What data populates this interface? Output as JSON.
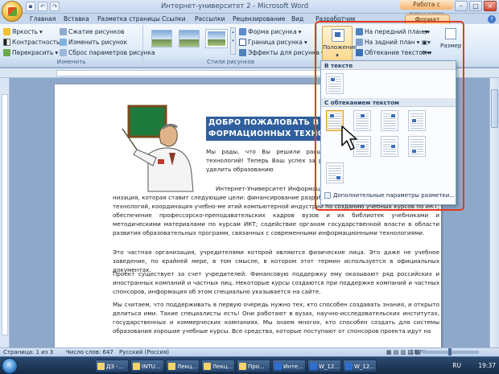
{
  "window": {
    "title": "Интернет-университет 2 - Microsoft Word",
    "context_title": "Работа с рисунками"
  },
  "tabs": [
    {
      "label": "Главная"
    },
    {
      "label": "Вставка"
    },
    {
      "label": "Разметка страницы"
    },
    {
      "label": "Ссылки"
    },
    {
      "label": "Рассылки"
    },
    {
      "label": "Рецензирование"
    },
    {
      "label": "Вид"
    },
    {
      "label": "Разработчик"
    },
    {
      "label": "Формат"
    }
  ],
  "ribbon": {
    "adjust": {
      "brightness": "Яркость",
      "contrast": "Контрастность",
      "recolor": "Перекрасить",
      "compress": "Сжатие рисунков",
      "change": "Изменить рисунок",
      "reset": "Сброс параметров рисунка",
      "label": "Изменить"
    },
    "styles": {
      "shape": "Форма рисунка",
      "border": "Граница рисунка",
      "effects": "Эффекты для рисунка",
      "label": "Стили рисунков"
    },
    "arrange": {
      "position": "Положение",
      "front": "На передний план",
      "back": "На задний план",
      "wrap": "Обтекание текстом"
    },
    "size": "Размер"
  },
  "popup": {
    "section_inline": "В тексте",
    "section_wrap": "С обтеканием текстом",
    "more": "Дополнительные параметры разметки..."
  },
  "document": {
    "heading": "ДОБРО ПОЖАЛОВАТЬ В И ФОРМАЦИОННЫХ ТЕХНОЛОГ",
    "p1": "Мы рады, что Вы решили расширить с ных технологий! Теперь Ваш успех за рые Вы готовы уделить образованию",
    "p2a": "Интернет-Университет Информацион",
    "p2b": "низация, которая ставит следующие цели: финансирование разработо формационно-коммуникационных технологий, координация учебно-ме ятий компьютерной индустрии по созданию учебных курсов по ИКТ; обеспечение профессорско-преподавательских кадров вузов и их библиотек учебниками и методическими материалами по курсам ИКТ; содействие органам государственной власти в области развития образовательных программ, связанных с современными информационными технологиями.",
    "p3": "Это частная организация, учредителями которой являются физические лица. Это даже не учебное заведение, по крайней мере, в том смысле, в котором этот термин используется в официальных документах.",
    "p4": "Проект существует за счет учредителей. Финансовую поддержку ему оказывают ряд российских и иностранных компаний и частных лиц. Некоторые курсы создаются при поддержке компаний и частных спонсоров, информация об этом специально указывается на сайте.",
    "p5": "Мы считаем, что поддерживать в первую очередь нужно тех, кто способен создавать знания, и открыто делиться ими. Такие специалисты есть! Они работают в вузах, научно-исследовательских институтах, государственных и коммерческих компаниях. Мы знаем многих, кто способен создать для системы образования хорошие учебные курсы. Все средства, которые поступают от спонсоров проекта идут на"
  },
  "status": {
    "page": "Страница: 1 из 3",
    "words": "Число слов: 647",
    "lang": "Русский (Россия)",
    "zoom": "100%"
  },
  "taskbar": {
    "items": [
      "ДЗ -...",
      "INTU...",
      "Лекц...",
      "Лекц...",
      "Про...",
      "Инте...",
      "W_12...",
      "W_12..."
    ],
    "lang": "RU",
    "time": "19:37"
  },
  "colors": {
    "accent_red": "#e23a1f",
    "heading_bg": "#2f5f9f",
    "highlight": "#ffd88a"
  }
}
